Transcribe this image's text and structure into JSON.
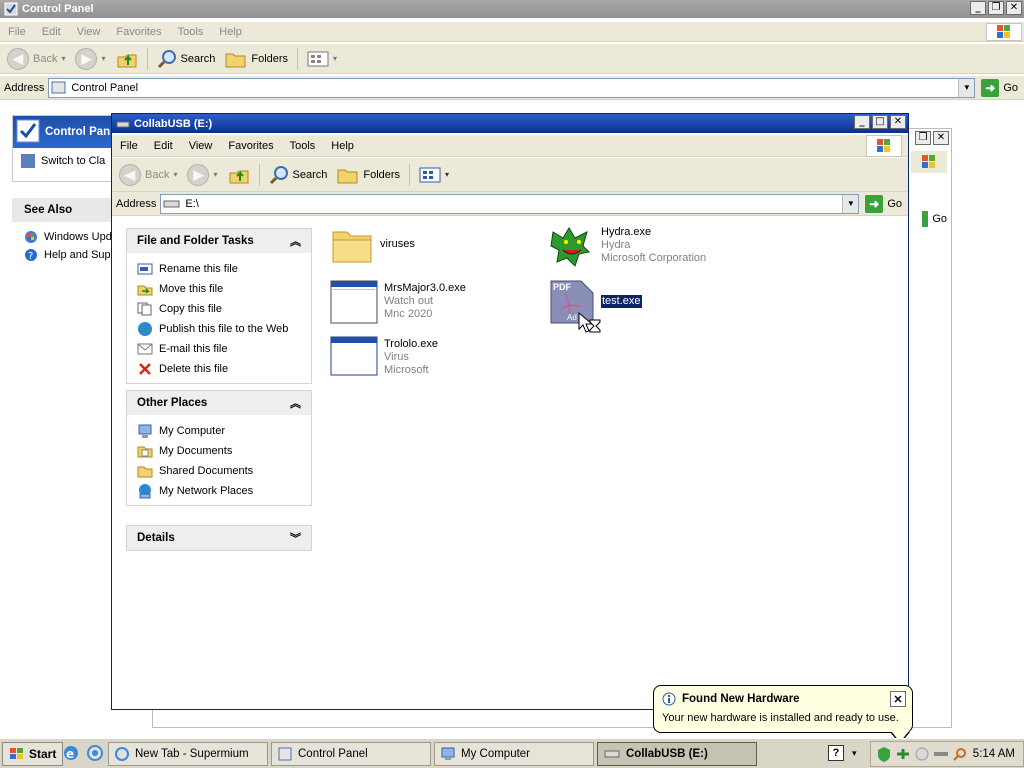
{
  "control_panel": {
    "title": "Control Panel",
    "menu": [
      "File",
      "Edit",
      "View",
      "Favorites",
      "Tools",
      "Help"
    ],
    "toolbar": {
      "back": "Back",
      "search": "Search",
      "folders": "Folders"
    },
    "address_label": "Address",
    "address_value": "Control Panel",
    "go": "Go",
    "side_header": "Control Pan",
    "switch_link": "Switch to Cla",
    "see_also_header": "See Also",
    "see_also_items": [
      "Windows Upd",
      "Help and Sup"
    ]
  },
  "collab": {
    "title": "CollabUSB (E:)",
    "menu": [
      "File",
      "Edit",
      "View",
      "Favorites",
      "Tools",
      "Help"
    ],
    "toolbar": {
      "back": "Back",
      "search": "Search",
      "folders": "Folders"
    },
    "address_label": "Address",
    "address_value": "E:\\",
    "go": "Go",
    "tasks": {
      "header": "File and Folder Tasks",
      "items": [
        "Rename this file",
        "Move this file",
        "Copy this file",
        "Publish this file to the Web",
        "E-mail this file",
        "Delete this file"
      ]
    },
    "other_places": {
      "header": "Other Places",
      "items": [
        "My Computer",
        "My Documents",
        "Shared Documents",
        "My Network Places"
      ]
    },
    "details": {
      "header": "Details"
    },
    "files": [
      {
        "name": "viruses",
        "line2": "",
        "line3": "",
        "icon": "folder-icon"
      },
      {
        "name": "Hydra.exe",
        "line2": "Hydra",
        "line3": "Microsoft Corporation",
        "icon": "hydra-icon"
      },
      {
        "name": "MrsMajor3.0.exe",
        "line2": "Watch out",
        "line3": "Mnc 2020",
        "icon": "exe-window-icon"
      },
      {
        "name": "test.exe",
        "line2": "",
        "line3": "",
        "icon": "pdf-icon"
      },
      {
        "name": "Trololo.exe",
        "line2": "Virus",
        "line3": "Microsoft",
        "icon": "exe-window-icon"
      }
    ],
    "pdf_icon_text": {
      "top": "PDF",
      "bottom": "Ad"
    }
  },
  "back_window": {
    "go": "Go"
  },
  "balloon": {
    "title": "Found New Hardware",
    "message": "Your new hardware is installed and ready to use."
  },
  "taskbar": {
    "start": "Start",
    "items": [
      "New Tab - Supermium",
      "Control Panel",
      "My Computer",
      "CollabUSB (E:)"
    ],
    "clock": "5:14 AM"
  }
}
